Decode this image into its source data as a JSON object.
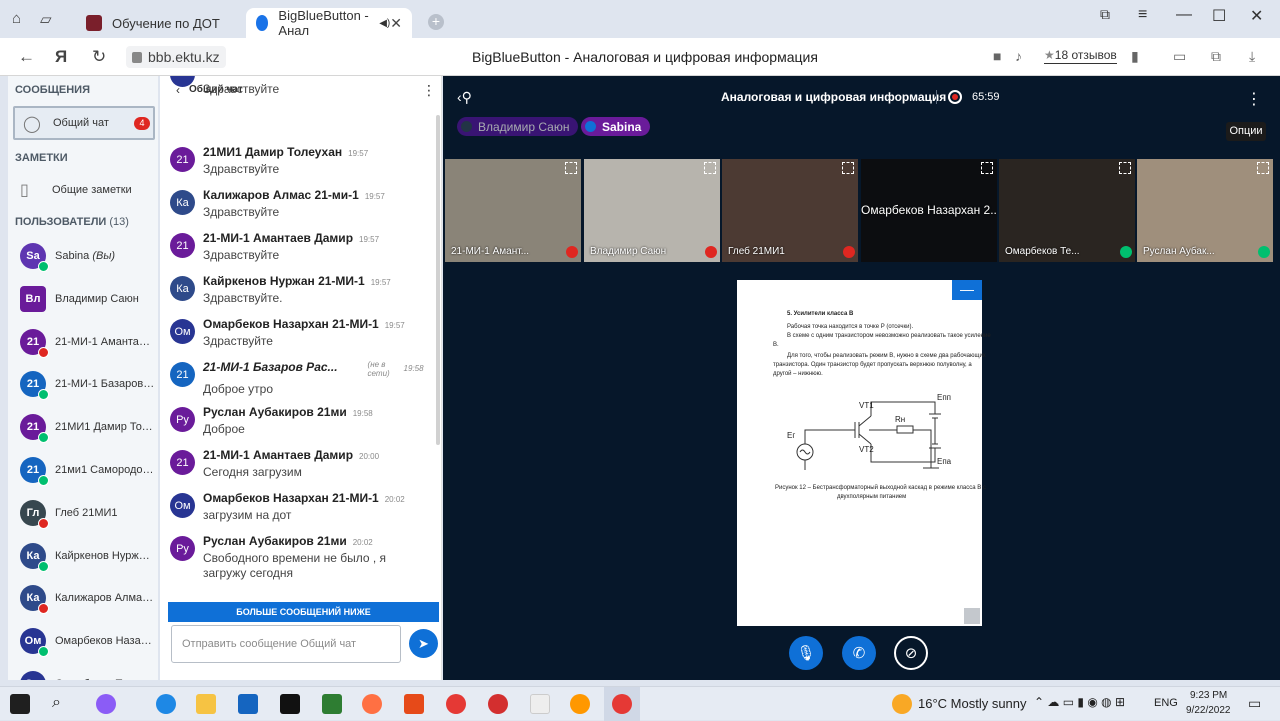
{
  "browser": {
    "tabs": [
      {
        "label": "Обучение по ДОТ"
      },
      {
        "label": "BigBlueButton - Анал"
      }
    ],
    "url": "bbb.ektu.kz",
    "page_title": "BigBlueButton - Аналоговая и цифровая информация",
    "reviews": "18 отзывов"
  },
  "sidebar": {
    "messages_heading": "СООБЩЕНИЯ",
    "public_chat_label": "Общий чат",
    "public_chat_badge": "4",
    "notes_heading": "ЗАМЕТКИ",
    "shared_notes_label": "Общие заметки",
    "users_heading": "ПОЛЬЗОВАТЕЛИ",
    "users_count": "(13)",
    "users": [
      {
        "initials": "Sa",
        "name": "Sabina",
        "suffix": "(Вы)",
        "color": "#5e35b1",
        "status": "#00bf6f",
        "square": false
      },
      {
        "initials": "Вл",
        "name": "Владимир Саюн",
        "suffix": "",
        "color": "#6a1b9a",
        "status": "",
        "square": true
      },
      {
        "initials": "21",
        "name": "21-МИ-1 Амантаев Дамир",
        "suffix": "",
        "color": "#6a1b9a",
        "status": "#df2721",
        "square": false
      },
      {
        "initials": "21",
        "name": "21-МИ-1 Базаров Расул",
        "suffix": "",
        "color": "#1565c0",
        "status": "#00bf6f",
        "square": false
      },
      {
        "initials": "21",
        "name": "21МИ1 Дамир Толеухан",
        "suffix": "",
        "color": "#6a1b9a",
        "status": "#00bf6f",
        "square": false
      },
      {
        "initials": "21",
        "name": "21ми1 Самородов Иван",
        "suffix": "",
        "color": "#1565c0",
        "status": "#00bf6f",
        "square": false
      },
      {
        "initials": "Гл",
        "name": "Глеб 21МИ1",
        "suffix": "",
        "color": "#37474f",
        "status": "#df2721",
        "square": false
      },
      {
        "initials": "Ка",
        "name": "Кайркенов Нуржан 21-МИ-1",
        "suffix": "",
        "color": "#2e4a8a",
        "status": "#00bf6f",
        "square": false
      },
      {
        "initials": "Ка",
        "name": "Калижаров Алмас 21-ми-1",
        "suffix": "",
        "color": "#2e4a8a",
        "status": "#df2721",
        "square": false
      },
      {
        "initials": "Ом",
        "name": "Омарбеков Назархан 21-МИ-1",
        "suffix": "",
        "color": "#283593",
        "status": "#00bf6f",
        "square": false
      },
      {
        "initials": "Ом",
        "name": "Омарбеков Темирлан",
        "suffix": "",
        "color": "#283593",
        "status": "",
        "square": false
      }
    ]
  },
  "chat": {
    "title": "Общий чат",
    "messages": [
      {
        "initials": "",
        "color": "#283593",
        "name": "",
        "time": "",
        "text": "Здравствуйте"
      },
      {
        "initials": "21",
        "color": "#6a1b9a",
        "name": "21МИ1 Дамир Толеухан",
        "time": "19:57",
        "text": "Здравствуйте"
      },
      {
        "initials": "Ка",
        "color": "#2e4a8a",
        "name": "Калижаров Алмас 21-ми-1",
        "time": "19:57",
        "text": "Здравствуйте"
      },
      {
        "initials": "21",
        "color": "#6a1b9a",
        "name": "21-МИ-1 Амантаев Дамир",
        "time": "19:57",
        "text": "Здравствуйте"
      },
      {
        "initials": "Ка",
        "color": "#2e4a8a",
        "name": "Кайркенов Нуржан 21-МИ-1",
        "time": "19:57",
        "text": "Здравствуйте."
      },
      {
        "initials": "Ом",
        "color": "#283593",
        "name": "Омарбеков Назархан 21-МИ-1",
        "time": "19:57",
        "text": "Здраствуйте"
      },
      {
        "initials": "21",
        "color": "#1565c0",
        "name": "21-МИ-1 Базаров Рас...",
        "time": "19:58",
        "text": "Доброе утро",
        "offline": "(не в сети)"
      },
      {
        "initials": "Ру",
        "color": "#6a1b9a",
        "name": "Руслан Аубакиров 21ми",
        "time": "19:58",
        "text": "Доброе"
      },
      {
        "initials": "21",
        "color": "#6a1b9a",
        "name": "21-МИ-1 Амантаев Дамир",
        "time": "20:00",
        "text": "Сегодня загрузим"
      },
      {
        "initials": "Ом",
        "color": "#283593",
        "name": "Омарбеков Назархан 21-МИ-1",
        "time": "20:02",
        "text": "загрузим на дот"
      },
      {
        "initials": "Ру",
        "color": "#6a1b9a",
        "name": "Руслан Аубакиров 21ми",
        "time": "20:02",
        "text": "Свободного времени не было , я загружу сегодня"
      }
    ],
    "more_below": "БОЛЬШЕ СООБЩЕНИЙ НИЖЕ",
    "input_placeholder": "Отправить сообщение Общий чат"
  },
  "meeting": {
    "title": "Аналоговая и цифровая информация",
    "elapsed": "65:59",
    "talkers": [
      {
        "name": "Владимир Саюн"
      },
      {
        "name": "Sabina"
      }
    ],
    "options_tooltip": "Опции",
    "videos": [
      {
        "caption": "21-МИ-1 Амант...",
        "bg": "#8a8478"
      },
      {
        "caption": "Владимир Саюн",
        "bg": "#b7b4ad"
      },
      {
        "caption": "Глеб 21МИ1",
        "bg": "#4c3a33"
      },
      {
        "caption": "Омарбеков Назархан 2...",
        "bg": "#0c0d10"
      },
      {
        "caption": "Омарбеков Те...",
        "bg": "#2a2521"
      },
      {
        "caption": "Руслан Аубак...",
        "bg": "#9f8f7c"
      }
    ],
    "slide": {
      "heading": "5.  Усилители класса В",
      "para1": "Рабочая точка находится в точке Р (отсечки).",
      "para2": "В схеме с одним транзистором невозможно реализовать такое усиление",
      "para2b": "В.",
      "para3": "Для того, чтобы реализовать режим В, нужно в схеме два рабочающих",
      "para3b": "транзистора. Один транзистор будет пропускать верхнюю полуволну, а",
      "para3c": "другой – нижнюю.",
      "caption1": "Рисунок 12 – Бестрансформаторный выходной каскад в режиме класса В с",
      "caption2": "двухполярным питанием",
      "label_vt1": "VT1",
      "label_vt2": "VT2",
      "label_rn": "Rн",
      "label_ep": "Eпп",
      "label_en": "Eпа",
      "label_eg": "Eг"
    }
  },
  "taskbar": {
    "weather": "16°C  Mostly sunny",
    "lang": "ENG",
    "time": "9:23 PM",
    "date": "9/22/2022"
  }
}
